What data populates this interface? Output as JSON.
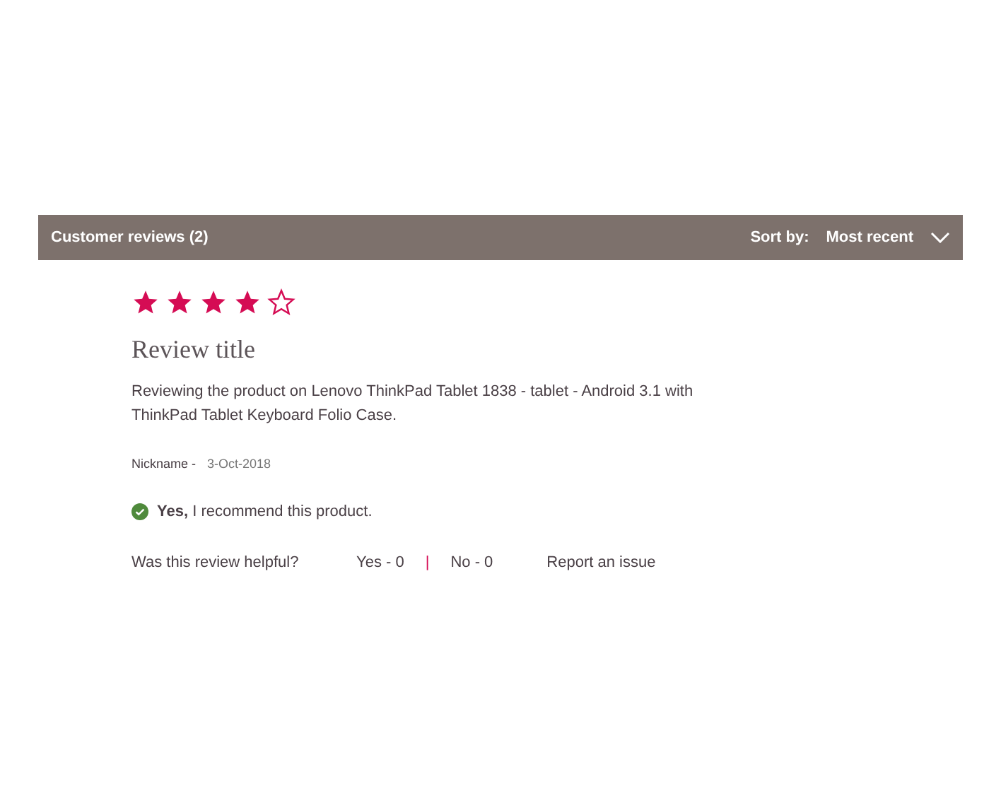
{
  "header": {
    "title": "Customer reviews (2)",
    "sort_label": "Sort by:",
    "sort_value": "Most recent"
  },
  "review": {
    "stars": 4,
    "title": "Review title",
    "body": "Reviewing the product on Lenovo ThinkPad Tablet 1838 - tablet - Android 3.1 with ThinkPad Tablet Keyboard Folio Case.",
    "nickname": "Nickname -",
    "date": "3-Oct-2018",
    "recommend": "**Yes,** I recommend this product.",
    "helpful": {
      "question": "Was this review helpful?",
      "yes": "Yes - 0",
      "separator": "|",
      "no": "No - 0",
      "report": "Report an issue"
    }
  }
}
